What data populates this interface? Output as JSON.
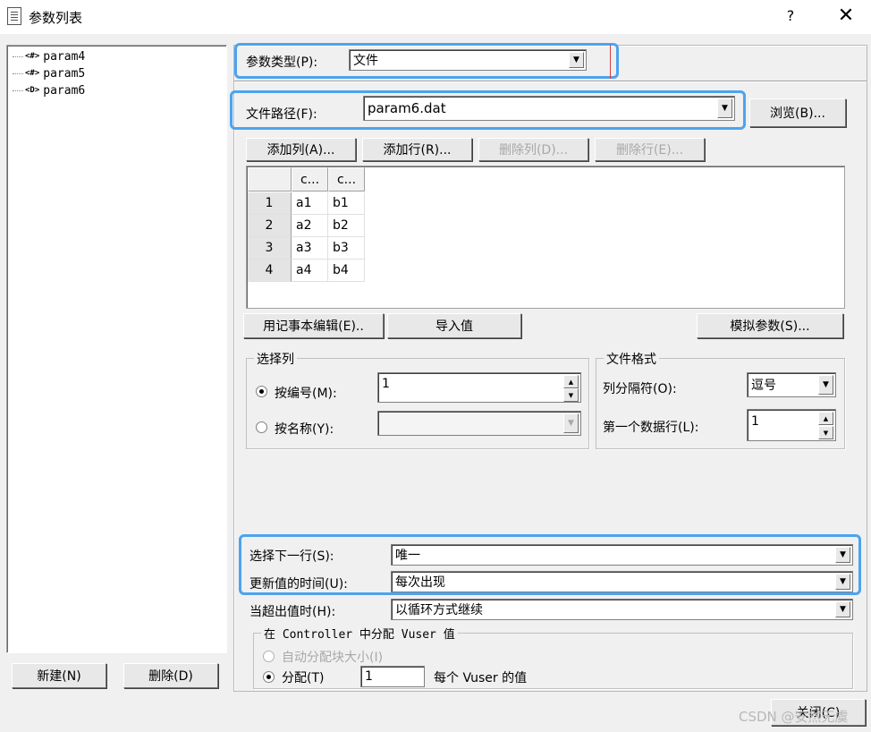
{
  "window": {
    "title": "参数列表",
    "help": "?",
    "close": "✕"
  },
  "tree": {
    "items": [
      {
        "label": "param4",
        "icon": "<#>"
      },
      {
        "label": "param5",
        "icon": "<#>"
      },
      {
        "label": "param6",
        "icon": "<D>"
      }
    ]
  },
  "left_buttons": {
    "new": "新建(N)",
    "delete": "删除(D)"
  },
  "param_type": {
    "label": "参数类型(P):",
    "value": "文件"
  },
  "file_path": {
    "label": "文件路径(F):",
    "value": "param6.dat",
    "browse": "浏览(B)..."
  },
  "grid_buttons": {
    "add_col": "添加列(A)...",
    "add_row": "添加行(R)...",
    "del_col": "删除列(D)...",
    "del_row": "删除行(E)..."
  },
  "grid": {
    "columns": [
      "c...",
      "c..."
    ],
    "rows": [
      {
        "n": "1",
        "c1": "a1",
        "c2": "b1"
      },
      {
        "n": "2",
        "c1": "a2",
        "c2": "b2"
      },
      {
        "n": "3",
        "c1": "a3",
        "c2": "b3"
      },
      {
        "n": "4",
        "c1": "a4",
        "c2": "b4"
      }
    ]
  },
  "actions": {
    "notepad": "用记事本编辑(E)..",
    "import": "导入值",
    "simulate": "模拟参数(S)..."
  },
  "select_column": {
    "title": "选择列",
    "by_number": "按编号(M):",
    "number_value": "1",
    "by_name": "按名称(Y):",
    "selected": "by_number"
  },
  "file_format": {
    "title": "文件格式",
    "delimiter_label": "列分隔符(O):",
    "delimiter_value": "逗号",
    "first_row_label": "第一个数据行(L):",
    "first_row_value": "1"
  },
  "next_row": {
    "label": "选择下一行(S):",
    "value": "唯一"
  },
  "update": {
    "label": "更新值的时间(U):",
    "value": "每次出现"
  },
  "out_of_values": {
    "label": "当超出值时(H):",
    "value": "以循环方式继续"
  },
  "controller": {
    "title": "在 Controller 中分配 Vuser 值",
    "auto": "自动分配块大小(I)",
    "allocate": "分配(T)",
    "allocate_value": "1",
    "per_vuser": "每个 Vuser 的值"
  },
  "close_button": "关闭(C)",
  "watermark": "CSDN @安然无虞",
  "colors": {
    "highlight": "#4da3ee",
    "background": "#f0f0f0"
  }
}
